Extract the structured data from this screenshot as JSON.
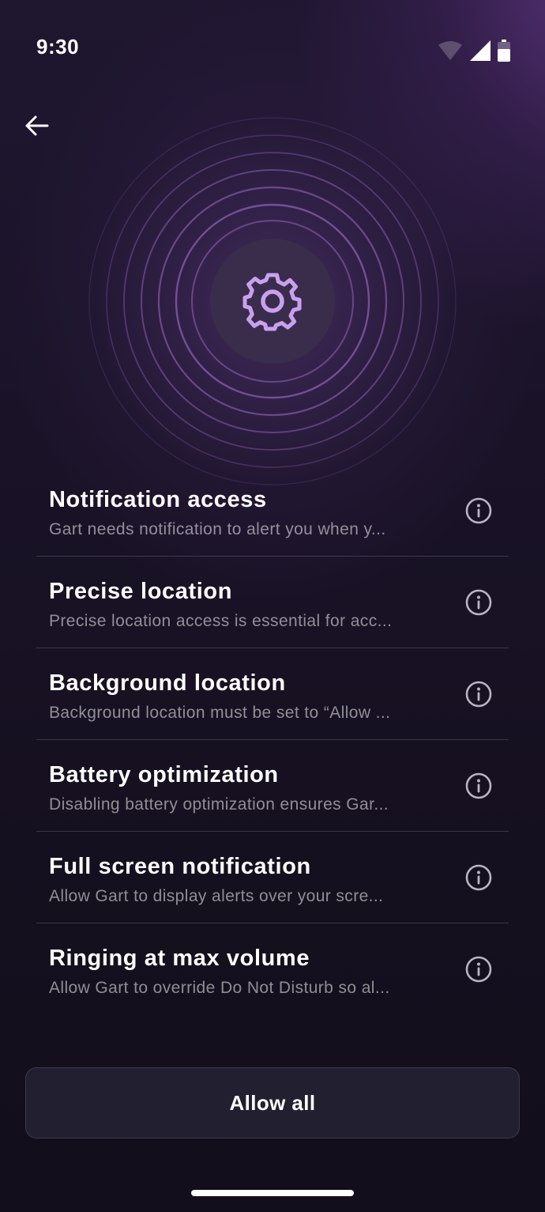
{
  "status_bar": {
    "time": "9:30",
    "icons": [
      "wifi-icon",
      "cellular-signal-icon",
      "battery-icon"
    ]
  },
  "header": {
    "back_icon": "arrow-left-icon"
  },
  "hero": {
    "icon": "gear-icon",
    "accent_color": "#c9a0ef",
    "ring_color": "#8a5fb4"
  },
  "permissions": [
    {
      "title": "Notification access",
      "description": "Gart needs notification to alert you when y...",
      "icon": "info-icon"
    },
    {
      "title": "Precise location",
      "description": "Precise location access is essential for acc...",
      "icon": "info-icon"
    },
    {
      "title": "Background location",
      "description": "Background location must be set to “Allow ...",
      "icon": "info-icon"
    },
    {
      "title": "Battery optimization",
      "description": "Disabling battery optimization ensures Gar...",
      "icon": "info-icon"
    },
    {
      "title": "Full screen notification",
      "description": "Allow Gart to display alerts over your scre...",
      "icon": "info-icon"
    },
    {
      "title": "Ringing at max volume",
      "description": "Allow Gart to override Do Not Disturb so al...",
      "icon": "info-icon"
    }
  ],
  "actions": {
    "allow_all_label": "Allow all"
  },
  "colors": {
    "background": "#1a1328",
    "accent": "#c9a0ef",
    "text_primary": "#ffffff",
    "text_secondary": "#8d8797"
  }
}
